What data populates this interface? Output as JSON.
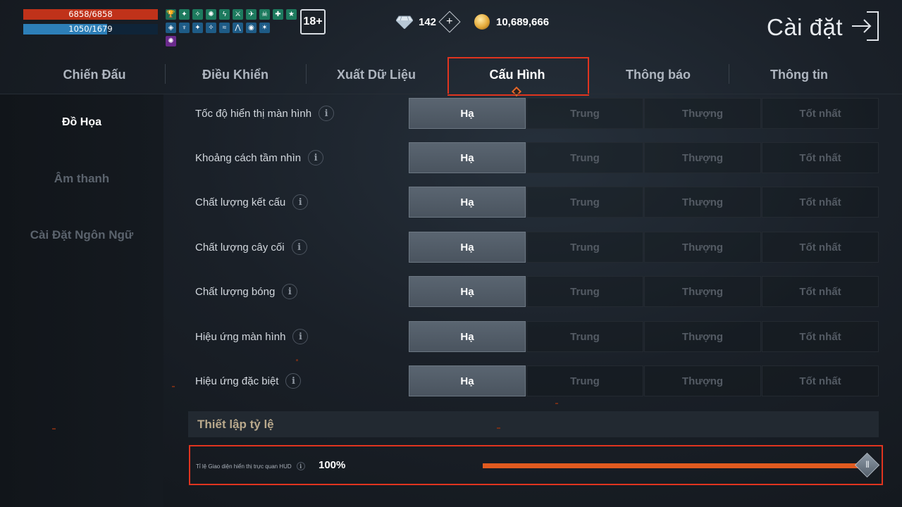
{
  "hud": {
    "hp_text": "6858/6858",
    "hp_fraction": 1.0,
    "mp_text": "1050/1679",
    "mp_fraction": 0.625,
    "age_rating": "18+",
    "colors": {
      "hp": "#c0321a",
      "mp": "#2d7fb8"
    }
  },
  "currency": {
    "diamonds": "142",
    "gold": "10,689,666"
  },
  "page_title": "Cài đặt",
  "tabs": [
    {
      "label": "Chiến Đấu",
      "active": false
    },
    {
      "label": "Điều Khiển",
      "active": false
    },
    {
      "label": "Xuất Dữ Liệu",
      "active": false
    },
    {
      "label": "Cấu Hình",
      "active": true
    },
    {
      "label": "Thông báo",
      "active": false
    },
    {
      "label": "Thông tin",
      "active": false
    }
  ],
  "sidebar": {
    "items": [
      {
        "label": "Đồ Họa",
        "active": true
      },
      {
        "label": "Âm thanh",
        "active": false
      },
      {
        "label": "Cài Đặt Ngôn Ngữ",
        "active": false
      }
    ]
  },
  "graphics": {
    "options": [
      "Hạ",
      "Trung",
      "Thượng",
      "Tốt nhất"
    ],
    "rows": [
      {
        "label": "Tốc độ hiển thị màn hình",
        "selected": "Hạ"
      },
      {
        "label": "Khoảng cách tầm nhìn",
        "selected": "Hạ"
      },
      {
        "label": "Chất lượng kết cấu",
        "selected": "Hạ"
      },
      {
        "label": "Chất lượng cây cối",
        "selected": "Hạ"
      },
      {
        "label": "Chất lượng bóng",
        "selected": "Hạ"
      },
      {
        "label": "Hiệu ứng màn hình",
        "selected": "Hạ"
      },
      {
        "label": "Hiệu ứng đặc biệt",
        "selected": "Hạ"
      }
    ]
  },
  "scale_section": {
    "title": "Thiết lập tỷ lệ",
    "hud_label": "Tỉ lệ Giao diện hiển thị trực quan HUD",
    "hud_value": "100%",
    "hud_fraction": 1.0,
    "accent_color": "#e05a1f"
  },
  "icons": {
    "info": "i",
    "plus": "+",
    "slider_grip": "|||"
  }
}
